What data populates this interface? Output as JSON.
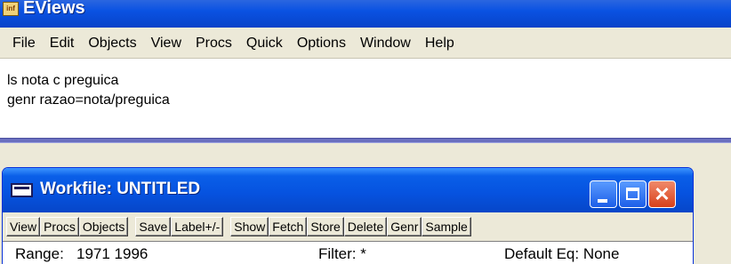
{
  "app": {
    "title": "EViews",
    "icon": "eviews-app-icon"
  },
  "menubar": {
    "items": [
      {
        "label": "File"
      },
      {
        "label": "Edit"
      },
      {
        "label": "Objects"
      },
      {
        "label": "View"
      },
      {
        "label": "Procs"
      },
      {
        "label": "Quick"
      },
      {
        "label": "Options"
      },
      {
        "label": "Window"
      },
      {
        "label": "Help"
      }
    ]
  },
  "command": {
    "lines": [
      "ls nota c preguica",
      "genr razao=nota/preguica"
    ]
  },
  "workfile": {
    "title": "Workfile: UNTITLED",
    "icon": "workfile-window-icon",
    "close_glyph": "✕",
    "toolbar_left": [
      "View",
      "Procs",
      "Objects"
    ],
    "toolbar_mid": [
      "Save",
      "Label+/-"
    ],
    "toolbar_right": [
      "Show",
      "Fetch",
      "Store",
      "Delete",
      "Genr",
      "Sample"
    ],
    "info": {
      "range": "Range:   1971 1996",
      "filter": "Filter: *",
      "default_eq": "Default Eq: None"
    }
  },
  "colors": {
    "titlebar_blue": "#0653e0",
    "menu_bg": "#ece9d8",
    "close_red": "#d8401a"
  }
}
